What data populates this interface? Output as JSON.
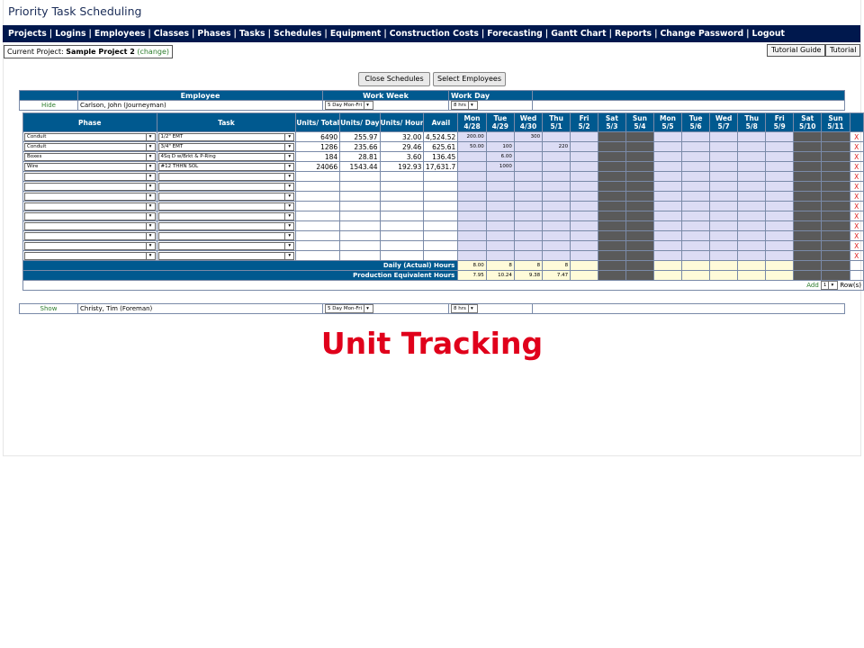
{
  "app_title": "Priority Task Scheduling",
  "nav": [
    "Projects",
    "Logins",
    "Employees",
    "Classes",
    "Phases",
    "Tasks",
    "Schedules",
    "Equipment",
    "Construction Costs",
    "Forecasting",
    "Gantt Chart",
    "Reports",
    "Change Password",
    "Logout"
  ],
  "current_project": {
    "label": "Current Project:",
    "name": "Sample Project 2",
    "change": "(change)"
  },
  "tutorial_buttons": [
    "Tutorial Guide",
    "Tutorial"
  ],
  "schedule_buttons": [
    "Close Schedules",
    "Select Employees"
  ],
  "employee_header": {
    "employee": "Employee",
    "work_week": "Work Week",
    "work_day": "Work Day"
  },
  "employees": [
    {
      "toggle": "Hide",
      "name": "Carlson, John (Journeyman)",
      "work_week": "5 Day Mon-Fri",
      "work_day": "8 hrs"
    },
    {
      "toggle": "Show",
      "name": "Christy, Tim (Foreman)",
      "work_week": "5 Day Mon-Fri",
      "work_day": "8 hrs"
    }
  ],
  "grid": {
    "col_headers": {
      "phase": "Phase",
      "task": "Task",
      "units_total": "Units/ Total",
      "units_day": "Units/ Day",
      "units_hour": "Units/ Hour",
      "avail": "Avail"
    },
    "days": [
      {
        "day": "Mon",
        "date": "4/28"
      },
      {
        "day": "Tue",
        "date": "4/29"
      },
      {
        "day": "Wed",
        "date": "4/30"
      },
      {
        "day": "Thu",
        "date": "5/1"
      },
      {
        "day": "Fri",
        "date": "5/2"
      },
      {
        "day": "Sat",
        "date": "5/3"
      },
      {
        "day": "Sun",
        "date": "5/4"
      },
      {
        "day": "Mon",
        "date": "5/5"
      },
      {
        "day": "Tue",
        "date": "5/6"
      },
      {
        "day": "Wed",
        "date": "5/7"
      },
      {
        "day": "Thu",
        "date": "5/8"
      },
      {
        "day": "Fri",
        "date": "5/9"
      },
      {
        "day": "Sat",
        "date": "5/10"
      },
      {
        "day": "Sun",
        "date": "5/11"
      }
    ],
    "rows": [
      {
        "phase": "Conduit",
        "task": "1/2\" EMT",
        "units_total": "6490",
        "units_day": "255.97",
        "units_hour": "32.00",
        "avail": "4,524.52",
        "cells": [
          "200.00",
          "",
          "300",
          "",
          "",
          "",
          "",
          "",
          "",
          "",
          "",
          "",
          "",
          ""
        ]
      },
      {
        "phase": "Conduit",
        "task": "3/4\" EMT",
        "units_total": "1286",
        "units_day": "235.66",
        "units_hour": "29.46",
        "avail": "625.61",
        "cells": [
          "50.00",
          "100",
          "",
          "220",
          "",
          "",
          "",
          "",
          "",
          "",
          "",
          "",
          "",
          ""
        ]
      },
      {
        "phase": "Boxes",
        "task": "4Sq D w/Brkt & P-Ring",
        "units_total": "184",
        "units_day": "28.81",
        "units_hour": "3.60",
        "avail": "136.45",
        "cells": [
          "",
          "6.00",
          "",
          "",
          "",
          "",
          "",
          "",
          "",
          "",
          "",
          "",
          "",
          ""
        ]
      },
      {
        "phase": "Wire",
        "task": "#12 THHN SOL",
        "units_total": "24066",
        "units_day": "1543.44",
        "units_hour": "192.93",
        "avail": "17,631.7",
        "cells": [
          "",
          "1000",
          "",
          "",
          "",
          "",
          "",
          "",
          "",
          "",
          "",
          "",
          "",
          ""
        ]
      },
      {
        "phase": "",
        "task": "",
        "units_total": "",
        "units_day": "",
        "units_hour": "",
        "avail": "",
        "cells": [
          "",
          "",
          "",
          "",
          "",
          "",
          "",
          "",
          "",
          "",
          "",
          "",
          "",
          ""
        ]
      },
      {
        "phase": "",
        "task": "",
        "units_total": "",
        "units_day": "",
        "units_hour": "",
        "avail": "",
        "cells": [
          "",
          "",
          "",
          "",
          "",
          "",
          "",
          "",
          "",
          "",
          "",
          "",
          "",
          ""
        ]
      },
      {
        "phase": "",
        "task": "",
        "units_total": "",
        "units_day": "",
        "units_hour": "",
        "avail": "",
        "cells": [
          "",
          "",
          "",
          "",
          "",
          "",
          "",
          "",
          "",
          "",
          "",
          "",
          "",
          ""
        ]
      },
      {
        "phase": "",
        "task": "",
        "units_total": "",
        "units_day": "",
        "units_hour": "",
        "avail": "",
        "cells": [
          "",
          "",
          "",
          "",
          "",
          "",
          "",
          "",
          "",
          "",
          "",
          "",
          "",
          ""
        ]
      },
      {
        "phase": "",
        "task": "",
        "units_total": "",
        "units_day": "",
        "units_hour": "",
        "avail": "",
        "cells": [
          "",
          "",
          "",
          "",
          "",
          "",
          "",
          "",
          "",
          "",
          "",
          "",
          "",
          ""
        ]
      },
      {
        "phase": "",
        "task": "",
        "units_total": "",
        "units_day": "",
        "units_hour": "",
        "avail": "",
        "cells": [
          "",
          "",
          "",
          "",
          "",
          "",
          "",
          "",
          "",
          "",
          "",
          "",
          "",
          ""
        ]
      },
      {
        "phase": "",
        "task": "",
        "units_total": "",
        "units_day": "",
        "units_hour": "",
        "avail": "",
        "cells": [
          "",
          "",
          "",
          "",
          "",
          "",
          "",
          "",
          "",
          "",
          "",
          "",
          "",
          ""
        ]
      },
      {
        "phase": "",
        "task": "",
        "units_total": "",
        "units_day": "",
        "units_hour": "",
        "avail": "",
        "cells": [
          "",
          "",
          "",
          "",
          "",
          "",
          "",
          "",
          "",
          "",
          "",
          "",
          "",
          ""
        ]
      },
      {
        "phase": "",
        "task": "",
        "units_total": "",
        "units_day": "",
        "units_hour": "",
        "avail": "",
        "cells": [
          "",
          "",
          "",
          "",
          "",
          "",
          "",
          "",
          "",
          "",
          "",
          "",
          "",
          ""
        ]
      }
    ],
    "remove_label": "X",
    "daily_label": "Daily (Actual) Hours",
    "daily_hours": [
      "8.00",
      "8",
      "8",
      "8",
      "",
      "",
      "",
      "",
      "",
      "",
      "",
      "",
      "",
      ""
    ],
    "prod_label": "Production Equivalent Hours",
    "prod_hours": [
      "7.95",
      "10.24",
      "9.38",
      "7.47",
      "",
      "",
      "",
      "",
      "",
      "",
      "",
      "",
      "",
      ""
    ],
    "add": {
      "label": "Add",
      "count": "1",
      "suffix": "Row(s)"
    }
  },
  "caption": "Unit Tracking"
}
